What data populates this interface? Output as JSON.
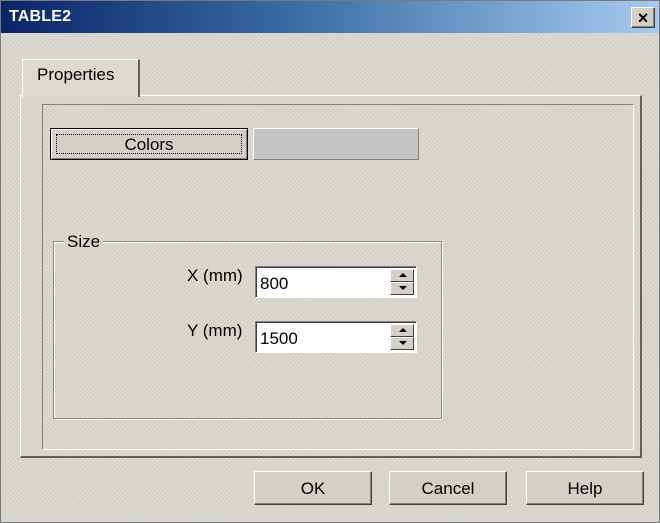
{
  "window": {
    "title": "TABLE2",
    "close_glyph": "✕"
  },
  "tabs": [
    {
      "label": "Properties",
      "selected": true
    }
  ],
  "colors": {
    "button_label": "Colors",
    "swatch_color": "#c4c4c4"
  },
  "size_group": {
    "title": "Size",
    "x": {
      "label": "X (mm)",
      "value": "800"
    },
    "y": {
      "label": "Y (mm)",
      "value": "1500"
    }
  },
  "buttons": {
    "ok": "OK",
    "cancel": "Cancel",
    "help": "Help"
  }
}
